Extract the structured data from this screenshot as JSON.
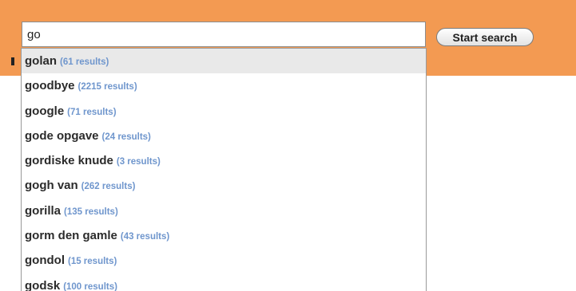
{
  "search": {
    "value": "go",
    "button_label": "Start search"
  },
  "suggestions": [
    {
      "term": "golan",
      "count": "(61 results)",
      "highlighted": true
    },
    {
      "term": "goodbye",
      "count": "(2215 results)"
    },
    {
      "term": "google",
      "count": "(71 results)"
    },
    {
      "term": "gode opgave",
      "count": "(24 results)"
    },
    {
      "term": "gordiske knude",
      "count": "(3 results)"
    },
    {
      "term": "gogh van",
      "count": "(262 results)"
    },
    {
      "term": "gorilla",
      "count": "(135 results)"
    },
    {
      "term": "gorm den gamle",
      "count": "(43 results)"
    },
    {
      "term": "gondol",
      "count": "(15 results)"
    },
    {
      "term": "godsk",
      "count": "(100 results)"
    }
  ],
  "colors": {
    "header_background": "#f39a52",
    "count_text": "#6f96cd",
    "highlight_row": "#e9e9e9"
  }
}
